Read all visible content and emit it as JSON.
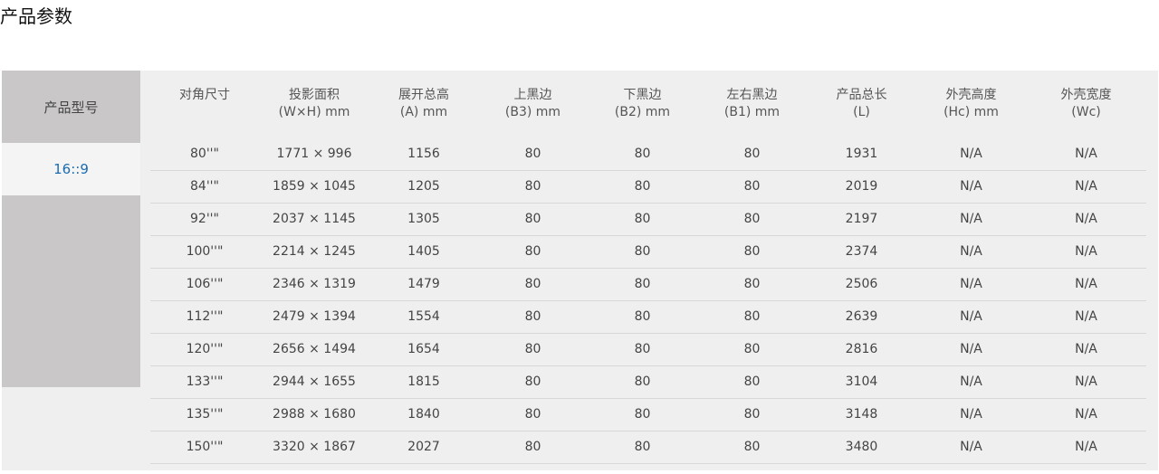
{
  "page": {
    "title": "产品参数"
  },
  "sidebar": {
    "header": "产品型号",
    "ratio": "16::9"
  },
  "colors": {
    "panel_bg": "#efefef",
    "side_header_bg": "#c9c7c8",
    "ratio_text": "#1a6cb0"
  },
  "table": {
    "headers": [
      {
        "line1": "对角尺寸",
        "line2": ""
      },
      {
        "line1": "投影面积",
        "line2": "(W×H) mm"
      },
      {
        "line1": "展开总高",
        "line2": "(A) mm"
      },
      {
        "line1": "上黑边",
        "line2": "(B3) mm"
      },
      {
        "line1": "下黑边",
        "line2": "(B2) mm"
      },
      {
        "line1": "左右黑边",
        "line2": "(B1) mm"
      },
      {
        "line1": "产品总长",
        "line2": "(L)"
      },
      {
        "line1": "外壳高度",
        "line2": "(Hc) mm"
      },
      {
        "line1": "外壳宽度",
        "line2": "(Wc)"
      }
    ],
    "rows": [
      [
        "80''\"",
        "1771 × 996",
        "1156",
        "80",
        "80",
        "80",
        "1931",
        "N/A",
        "N/A"
      ],
      [
        "84''\"",
        "1859 × 1045",
        "1205",
        "80",
        "80",
        "80",
        "2019",
        "N/A",
        "N/A"
      ],
      [
        "92''\"",
        "2037 × 1145",
        "1305",
        "80",
        "80",
        "80",
        "2197",
        "N/A",
        "N/A"
      ],
      [
        "100''\"",
        "2214 × 1245",
        "1405",
        "80",
        "80",
        "80",
        "2374",
        "N/A",
        "N/A"
      ],
      [
        "106''\"",
        "2346 × 1319",
        "1479",
        "80",
        "80",
        "80",
        "2506",
        "N/A",
        "N/A"
      ],
      [
        "112''\"",
        "2479 × 1394",
        "1554",
        "80",
        "80",
        "80",
        "2639",
        "N/A",
        "N/A"
      ],
      [
        "120''\"",
        "2656 × 1494",
        "1654",
        "80",
        "80",
        "80",
        "2816",
        "N/A",
        "N/A"
      ],
      [
        "133''\"",
        "2944 × 1655",
        "1815",
        "80",
        "80",
        "80",
        "3104",
        "N/A",
        "N/A"
      ],
      [
        "135''\"",
        "2988 × 1680",
        "1840",
        "80",
        "80",
        "80",
        "3148",
        "N/A",
        "N/A"
      ],
      [
        "150''\"",
        "3320 × 1867",
        "2027",
        "80",
        "80",
        "80",
        "3480",
        "N/A",
        "N/A"
      ]
    ]
  }
}
